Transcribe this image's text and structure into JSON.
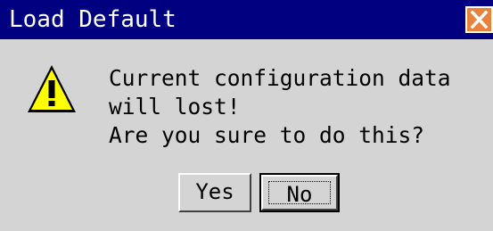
{
  "window": {
    "title": "Load Default"
  },
  "icons": {
    "close": "close-icon",
    "warning": "warning-icon"
  },
  "message": {
    "lines": [
      "Current configuration data",
      "will lost!",
      "Are you sure to do this?"
    ]
  },
  "buttons": {
    "yes_label": "Yes",
    "no_label": "No"
  },
  "colors": {
    "titlebar": "#000080",
    "close_button": "#e8823c",
    "warning_fill": "#ffff00"
  }
}
